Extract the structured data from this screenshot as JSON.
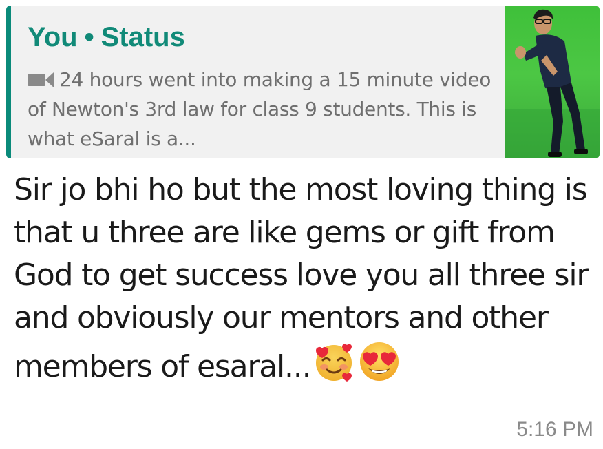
{
  "quoted_status": {
    "author": "You",
    "separator": "•",
    "label": "Status",
    "media_icon": "video-camera-icon",
    "preview_text": "24 hours went into making a 15 minute video of Newton's 3rd law for class 9 students. This is what eSaral is a...",
    "thumbnail": "status-video-thumbnail",
    "accent_color": "#0a8a7a"
  },
  "message": {
    "text": "Sir jo bhi ho but the most loving thing is that u three are like gems or gift from God to get success love you all three sir and obviously our mentors and other members of esaral...",
    "emojis": [
      "smiling-face-with-hearts-icon",
      "heart-eyes-icon"
    ],
    "time": "5:16 PM"
  }
}
